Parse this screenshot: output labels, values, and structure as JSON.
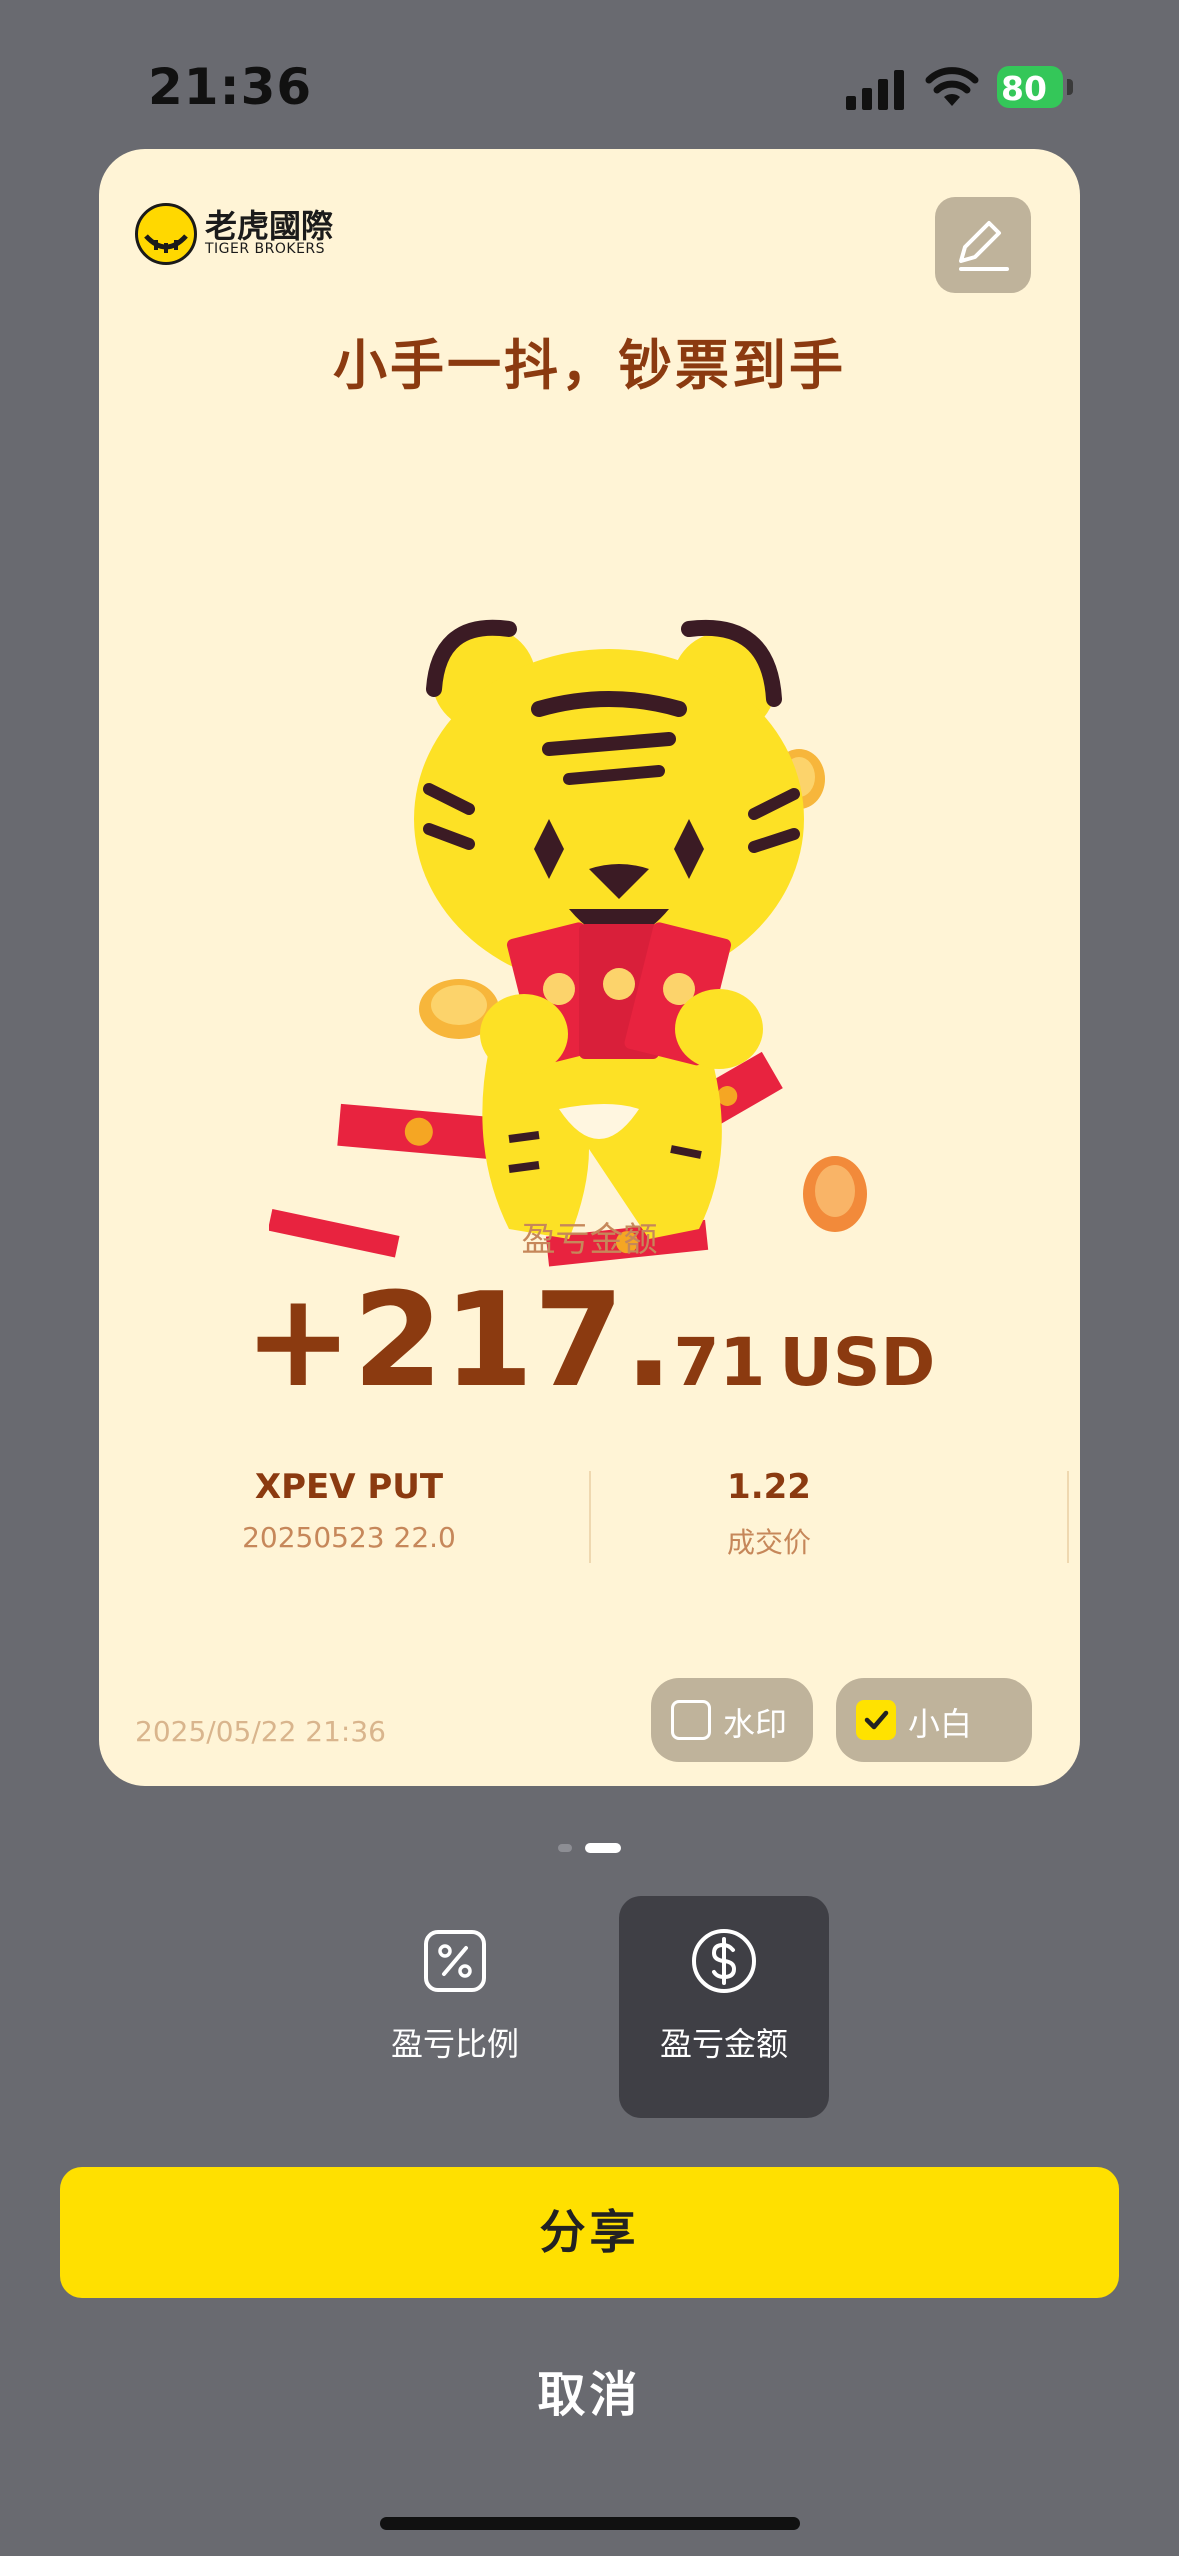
{
  "status_bar": {
    "time": "21:36",
    "battery": "80"
  },
  "card": {
    "logo": {
      "name_cn": "老虎國際",
      "name_en": "TIGER BROKERS"
    },
    "headline": "小手一抖，钞票到手",
    "pnl_label": "盈亏金额",
    "pnl_sign_int": "+217",
    "pnl_dot": ".",
    "pnl_decimal": "71",
    "pnl_currency": "USD",
    "info": [
      {
        "main": "XPEV PUT",
        "sub": "20250523  22.0"
      },
      {
        "main": "1.22",
        "sub": "成交价"
      }
    ],
    "timestamp": "2025/05/22 21:36",
    "toggles": [
      {
        "label": "水印",
        "checked": false
      },
      {
        "label": "小白",
        "checked": true
      }
    ]
  },
  "pagination": {
    "current": 2,
    "total": 2
  },
  "modes": [
    {
      "label": "盈亏比例",
      "icon": "percent-icon",
      "selected": false
    },
    {
      "label": "盈亏金额",
      "icon": "dollar-icon",
      "selected": true
    }
  ],
  "actions": {
    "share": "分享",
    "cancel": "取消"
  },
  "colors": {
    "accent": "#ffe000",
    "card_bg": "#fff4d6",
    "brand_text": "#8b3a10",
    "overlay": "#696a70"
  }
}
